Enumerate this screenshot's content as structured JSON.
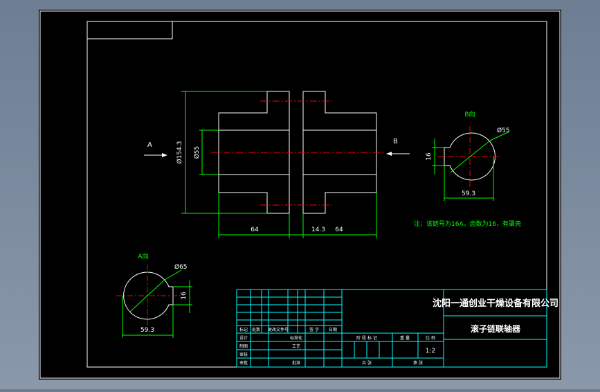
{
  "colors": {
    "background": "#000000",
    "border": "#ffffff",
    "dimension": "#00ff00",
    "centerline": "#ff0000",
    "title_block_line": "#00ffff",
    "text": "#ffffff",
    "note_text": "#00ff00"
  },
  "views": {
    "section_a_label": "A",
    "section_b_label": "B",
    "b_view_title": "B向",
    "a_view_title": "A向"
  },
  "dimensions": {
    "overall_dia": "Ø154.3",
    "bore_dia": "Ø55",
    "left_length": "64",
    "gap": "14.3",
    "right_length": "64",
    "b_view_dia": "Ø55",
    "b_view_key": "16",
    "b_view_width": "59.3",
    "a_view_dia": "Ø65",
    "a_view_key": "16",
    "a_view_width": "59.3"
  },
  "note": "注：该链号为16A，齿数为16，有罩壳",
  "title_block": {
    "company": "沈阳一通创业干燥设备有限公司",
    "drawing_title": "滚子链联轴器",
    "scale": "1:2",
    "row_labels": {
      "mark": "标记",
      "count": "处数",
      "change_doc": "更改文件号",
      "signature": "签 字",
      "date": "日期",
      "design": "设计",
      "standardization": "标准化",
      "drafting": "制图",
      "process": "工艺",
      "check": "审核",
      "approve": "审批",
      "approval": "批准"
    },
    "stage_labels": {
      "stage_mark": "阶 段 标 记",
      "weight": "重 量",
      "ratio": "比 例",
      "sheets": "共 张",
      "sheet": "第 张"
    }
  }
}
